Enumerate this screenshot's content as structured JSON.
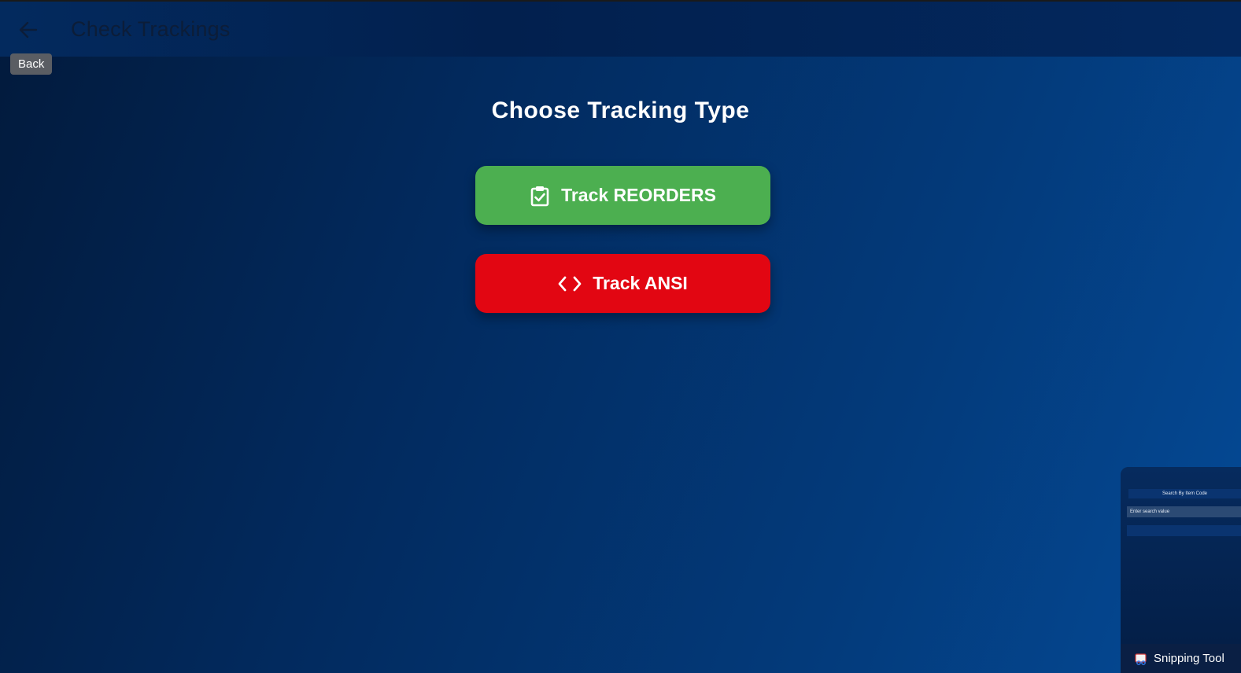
{
  "header": {
    "title": "Check Trackings",
    "back_tooltip": "Back"
  },
  "main": {
    "heading": "Choose Tracking Type",
    "buttons": [
      {
        "label": "Track REORDERS",
        "icon": "clipboard-check-icon",
        "color": "#4caf50"
      },
      {
        "label": "Track ANSI",
        "icon": "code-icon",
        "color": "#e20612"
      }
    ]
  },
  "snipping_tool": {
    "label": "Snipping Tool",
    "preview": {
      "title": "Search By Item Code",
      "input_placeholder": "Enter search value"
    }
  }
}
